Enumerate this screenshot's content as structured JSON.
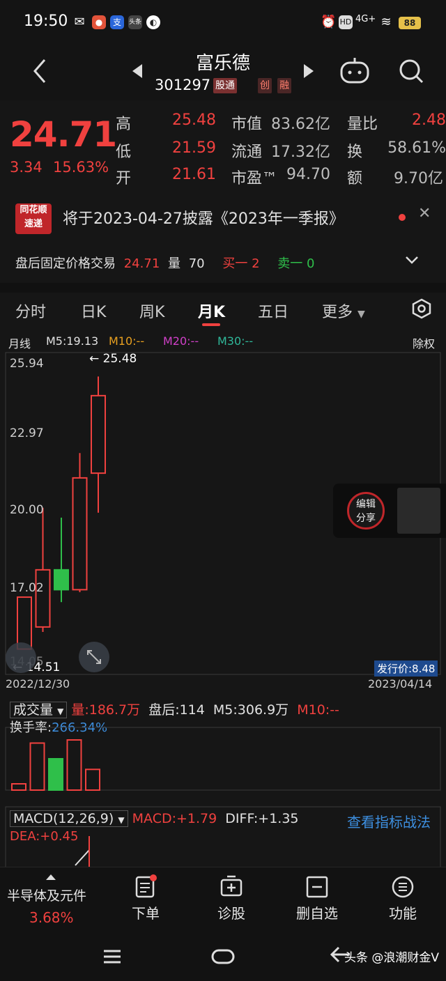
{
  "status_bar": {
    "time": "19:50",
    "network": "4G+",
    "battery": "88"
  },
  "header": {
    "name": "富乐德",
    "code": "301297",
    "tags": [
      "股通",
      "创",
      "融"
    ]
  },
  "quote": {
    "price": "24.71",
    "change": "3.34",
    "change_pct": "15.63%",
    "rows": [
      {
        "l1": "高",
        "v1": "25.48",
        "l2": "市值",
        "v2": "83.62亿",
        "l3": "量比",
        "v3": "2.48"
      },
      {
        "l1": "低",
        "v1": "21.59",
        "l2": "流通",
        "v2": "17.32亿",
        "l3": "换",
        "v3": "58.61%"
      },
      {
        "l1": "开",
        "v1": "21.61",
        "l2": "市盈™",
        "v2": "94.70",
        "l3": "额",
        "v3": "9.70亿"
      }
    ]
  },
  "announce": {
    "logo_top": "同花顺",
    "logo_bottom": "速递",
    "text": "将于2023-04-27披露《2023年一季报》"
  },
  "after_hours": {
    "label": "盘后固定价格交易",
    "price": "24.71",
    "vol_label": "量",
    "vol": "70",
    "buy": "买一 2",
    "sell": "卖一 0"
  },
  "tabs": [
    "分时",
    "日K",
    "周K",
    "月K",
    "五日",
    "更多"
  ],
  "chart": {
    "period": "月线",
    "m5": "M5:19.13",
    "m10": "M10:--",
    "m20": "M20:--",
    "m30": "M30:--",
    "adjust": "除权",
    "y_ticks": [
      "25.94",
      "22.97",
      "20.00",
      "17.02",
      "14.05"
    ],
    "high_label": "25.48",
    "low_label": "14.51",
    "date_start": "2022/12/30",
    "date_end": "2023/04/14",
    "issue_price": "发行价:8.48"
  },
  "chart_data": {
    "type": "candlestick",
    "x": [
      "2022-12",
      "2023-01",
      "2023-02",
      "2023-03",
      "2023-04"
    ],
    "ohlc": [
      {
        "open": 14.51,
        "high": 16.6,
        "low": 14.51,
        "close": 16.6
      },
      {
        "open": 15.4,
        "high": 20.2,
        "low": 15.2,
        "close": 17.7
      },
      {
        "open": 17.7,
        "high": 19.8,
        "low": 16.4,
        "close": 16.9
      },
      {
        "open": 16.9,
        "high": 22.4,
        "low": 16.8,
        "close": 21.4
      },
      {
        "open": 21.59,
        "high": 25.48,
        "low": 20.0,
        "close": 24.71
      }
    ],
    "volume": [
      0.1,
      0.75,
      0.5,
      0.8,
      0.33
    ],
    "ylim": [
      14.05,
      25.94
    ]
  },
  "share_widget": {
    "line1": "编辑",
    "line2": "分享"
  },
  "volume_panel": {
    "title": "成交量",
    "vol": "量:186.7万",
    "after": "盘后:114",
    "m5": "M5:306.9万",
    "m10": "M10:--",
    "turnover_label": "换手率:",
    "turnover": "266.34%"
  },
  "macd_panel": {
    "title": "MACD(12,26,9)",
    "macd": "MACD:+1.79",
    "diff": "DIFF:+1.35",
    "dea": "DEA:+0.45",
    "link": "查看指标战法"
  },
  "toolbar": {
    "sector": "半导体及元件",
    "sector_pct": "3.68%",
    "order": "下单",
    "diagnose": "诊股",
    "remove": "删自选",
    "functions": "功能"
  },
  "watermark": "头条 @浪潮财金V"
}
